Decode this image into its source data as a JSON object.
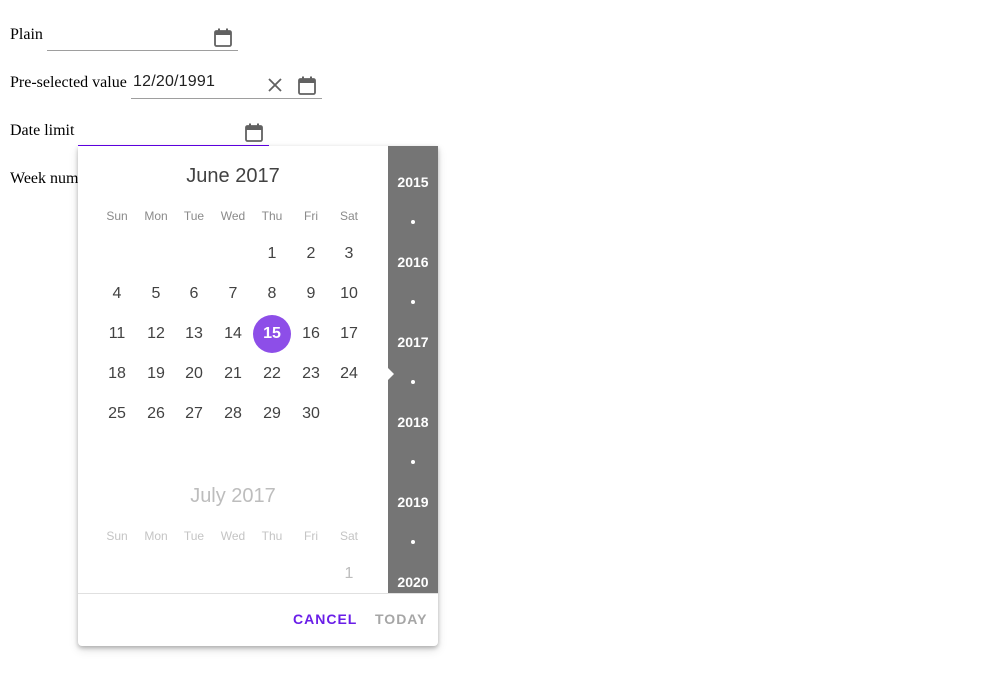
{
  "fields": {
    "plain": {
      "label": "Plain",
      "value": ""
    },
    "preselected": {
      "label": "Pre-selected value",
      "value": "12/20/1991"
    },
    "datelimit": {
      "label": "Date limit",
      "value": ""
    },
    "weeknum": {
      "label": "Week num"
    }
  },
  "icons": {
    "calendar": "calendar-icon",
    "clear": "close-icon"
  },
  "colors": {
    "accent": "#6200ea",
    "selected_day": "#8d4ee8",
    "year_rail": "#757575"
  },
  "picker": {
    "weekdays": [
      "Sun",
      "Mon",
      "Tue",
      "Wed",
      "Thu",
      "Fri",
      "Sat"
    ],
    "months": [
      {
        "title": "June 2017",
        "weeks": [
          [
            "",
            "",
            "",
            "",
            "1",
            "2",
            "3"
          ],
          [
            "4",
            "5",
            "6",
            "7",
            "8",
            "9",
            "10"
          ],
          [
            "11",
            "12",
            "13",
            "14",
            "15",
            "16",
            "17"
          ],
          [
            "18",
            "19",
            "20",
            "21",
            "22",
            "23",
            "24"
          ],
          [
            "25",
            "26",
            "27",
            "28",
            "29",
            "30",
            ""
          ]
        ],
        "selected": "15"
      },
      {
        "title": "July 2017",
        "weeks": [
          [
            "",
            "",
            "",
            "",
            "",
            "",
            "1"
          ]
        ]
      }
    ],
    "years": [
      "2015",
      "2016",
      "2017",
      "2018",
      "2019",
      "2020"
    ],
    "current_year": "2017",
    "actions": {
      "cancel": "CANCEL",
      "today": "TODAY"
    }
  }
}
